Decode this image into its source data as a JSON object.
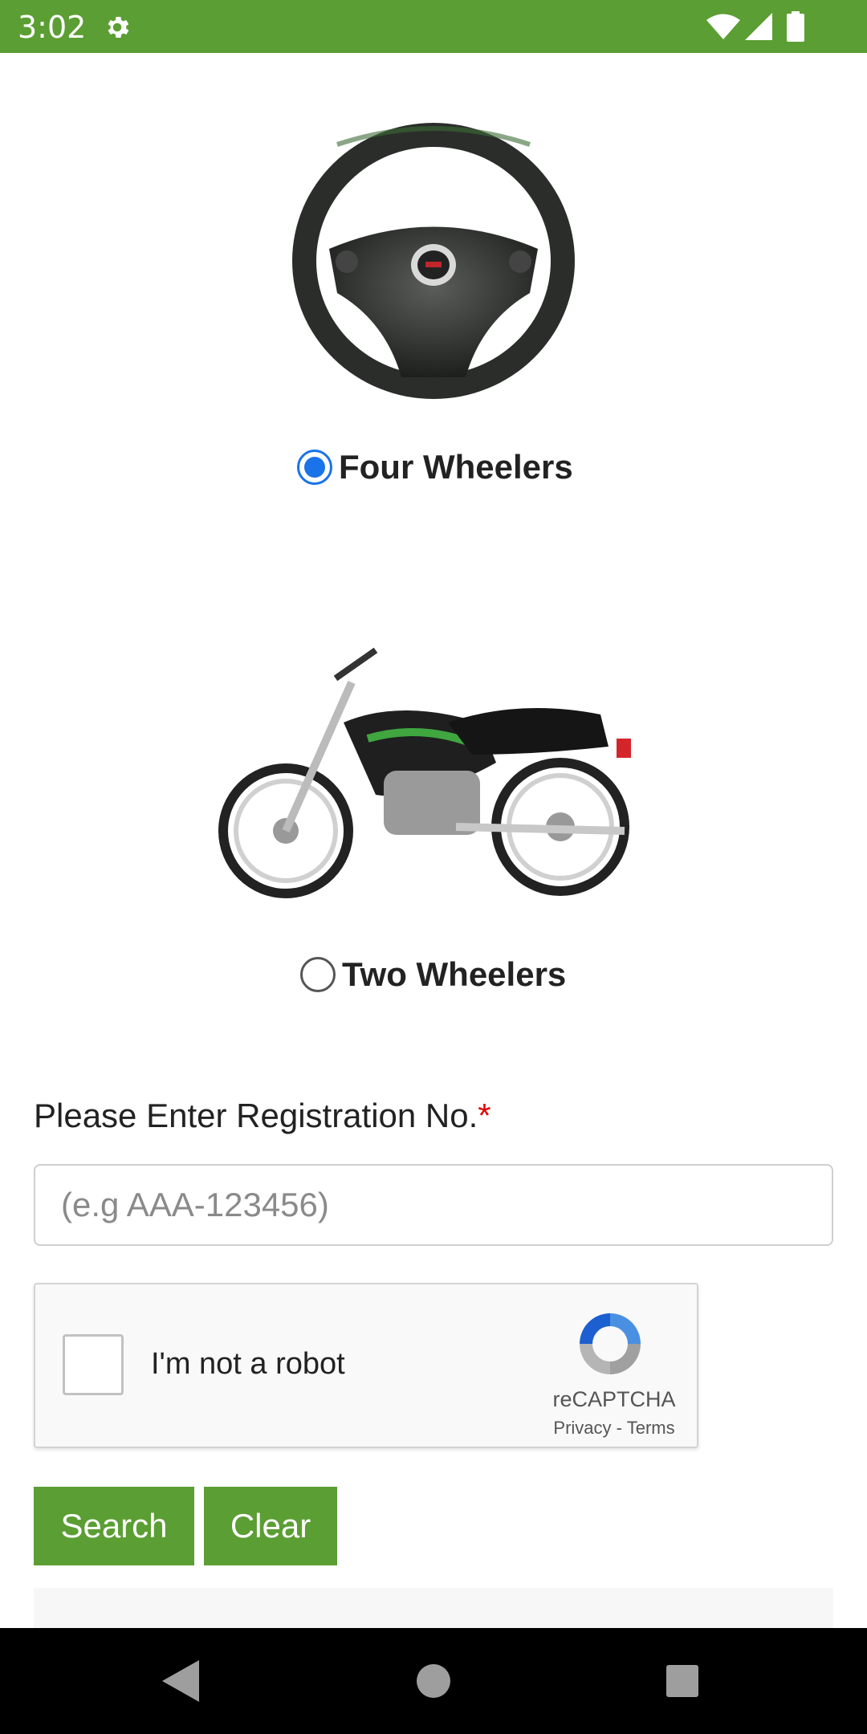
{
  "status_bar": {
    "time": "3:02",
    "icons": [
      "gear-icon",
      "wifi-icon",
      "signal-icon",
      "battery-icon"
    ],
    "background": "#5b9e33"
  },
  "vehicle_types": {
    "four_wheelers": {
      "label": "Four Wheelers",
      "selected": true,
      "image": "steering-wheel"
    },
    "two_wheelers": {
      "label": "Two Wheelers",
      "selected": false,
      "image": "motorcycle"
    }
  },
  "registration": {
    "label": "Please Enter Registration No.",
    "required_mark": "*",
    "placeholder": "(e.g AAA-123456)",
    "value": ""
  },
  "captcha": {
    "label": "I'm not a robot",
    "brand": "reCAPTCHA",
    "privacy": "Privacy",
    "separator": "-",
    "terms": "Terms"
  },
  "buttons": {
    "search": "Search",
    "clear": "Clear"
  },
  "colors": {
    "accent": "#5b9e33",
    "radio_selected": "#1a73e8",
    "required": "#e00000"
  },
  "nav_bar": {
    "icons": [
      "back-icon",
      "home-icon",
      "recents-icon"
    ]
  }
}
